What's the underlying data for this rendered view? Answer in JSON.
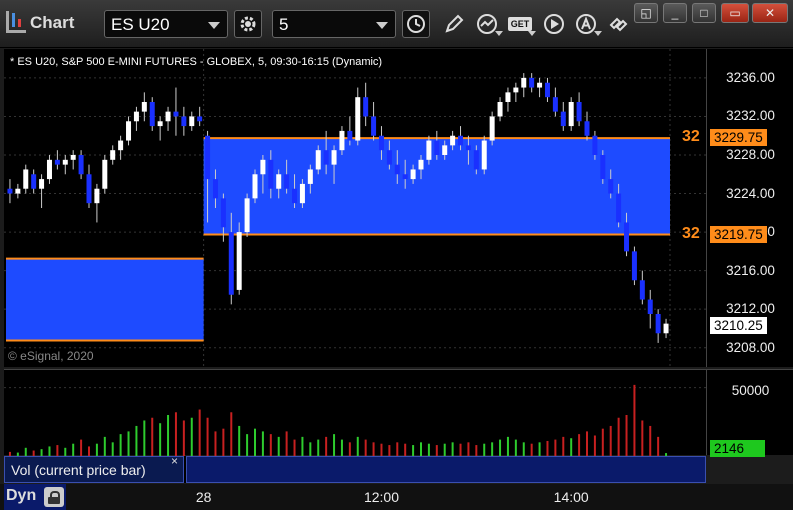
{
  "toolbar": {
    "app_title": "Chart",
    "symbol": "ES U20",
    "interval": "5",
    "get_label": "GET",
    "icons": [
      "gear-icon",
      "clock-icon",
      "pencil-icon",
      "study-icon",
      "get-data-icon",
      "play-icon",
      "text-icon",
      "link-icon"
    ]
  },
  "window": {
    "buttons": [
      "restore-icon",
      "minimize-icon",
      "maximize-icon",
      "close-icon"
    ]
  },
  "chart": {
    "header": "* ES U20, S&P 500 E-MINI FUTURES - GLOBEX, 5, 09:30-16:15 (Dynamic)",
    "copyright": "© eSignal, 2020",
    "price_axis_labels": [
      "3236.00",
      "3232.00",
      "3228.00",
      "3224.00",
      "3220.00",
      "3216.00",
      "3212.00",
      "3208.00"
    ],
    "upper_line_price": "3229.75",
    "lower_line_price": "3219.75",
    "last_price": "3210.25",
    "edge_label": "32",
    "volume_axis_label": "50000",
    "last_volume": "2146",
    "volume_panel_title": "Vol (current price bar)",
    "volume_panel_close": "×",
    "time_labels": [
      "28",
      "12:00",
      "14:00"
    ],
    "dyn_label": "Dyn",
    "colors": {
      "background": "#000000",
      "up_bar": "#ffffff",
      "down_bar": "#1a30ff",
      "zone_fill": "#1e4bff",
      "level_line": "#ff8c1a",
      "vol_up": "#2ecc2e",
      "vol_down": "#c82020"
    }
  },
  "chart_data": {
    "type": "bar",
    "title": "",
    "ylim": [
      3206,
      3239
    ],
    "ohlc": [
      [
        3224.5,
        3225.5,
        3223.0,
        3224.0
      ],
      [
        3224.0,
        3225.0,
        3223.5,
        3224.5
      ],
      [
        3224.5,
        3227.0,
        3224.0,
        3226.5
      ],
      [
        3226.0,
        3226.5,
        3224.0,
        3224.5
      ],
      [
        3224.5,
        3226.0,
        3222.5,
        3225.5
      ],
      [
        3225.5,
        3228.0,
        3225.0,
        3227.5
      ],
      [
        3227.5,
        3228.5,
        3226.5,
        3227.0
      ],
      [
        3227.0,
        3228.0,
        3226.0,
        3227.5
      ],
      [
        3227.5,
        3228.5,
        3226.5,
        3228.0
      ],
      [
        3228.0,
        3228.5,
        3225.5,
        3226.0
      ],
      [
        3226.0,
        3227.0,
        3222.5,
        3223.0
      ],
      [
        3223.0,
        3225.0,
        3221.0,
        3224.5
      ],
      [
        3224.5,
        3228.0,
        3224.0,
        3227.5
      ],
      [
        3227.5,
        3229.0,
        3227.0,
        3228.5
      ],
      [
        3228.5,
        3230.0,
        3227.5,
        3229.5
      ],
      [
        3229.5,
        3232.0,
        3229.0,
        3231.5
      ],
      [
        3231.5,
        3233.0,
        3230.5,
        3232.5
      ],
      [
        3232.5,
        3234.5,
        3231.5,
        3233.5
      ],
      [
        3233.5,
        3234.0,
        3230.5,
        3231.0
      ],
      [
        3231.0,
        3232.0,
        3229.5,
        3231.5
      ],
      [
        3231.5,
        3233.0,
        3230.5,
        3232.5
      ],
      [
        3232.5,
        3235.0,
        3230.0,
        3232.0
      ],
      [
        3232.0,
        3233.0,
        3230.0,
        3231.0
      ],
      [
        3231.0,
        3232.5,
        3230.5,
        3232.0
      ],
      [
        3232.0,
        3233.0,
        3231.0,
        3231.5
      ],
      [
        3230.0,
        3230.5,
        3221.0,
        3225.5
      ],
      [
        3225.5,
        3226.5,
        3222.5,
        3223.5
      ],
      [
        3223.5,
        3224.0,
        3219.0,
        3220.5
      ],
      [
        3220.0,
        3222.0,
        3212.5,
        3213.5
      ],
      [
        3214.0,
        3221.0,
        3213.5,
        3220.0
      ],
      [
        3220.0,
        3224.0,
        3219.5,
        3223.5
      ],
      [
        3223.5,
        3226.5,
        3223.0,
        3226.0
      ],
      [
        3226.0,
        3228.0,
        3224.0,
        3227.5
      ],
      [
        3227.5,
        3228.5,
        3223.5,
        3224.5
      ],
      [
        3224.5,
        3226.5,
        3223.5,
        3226.0
      ],
      [
        3226.0,
        3227.5,
        3224.0,
        3224.5
      ],
      [
        3224.5,
        3226.0,
        3222.5,
        3223.0
      ],
      [
        3223.0,
        3225.5,
        3222.5,
        3225.0
      ],
      [
        3225.0,
        3227.0,
        3224.0,
        3226.5
      ],
      [
        3226.5,
        3229.0,
        3226.0,
        3228.5
      ],
      [
        3228.5,
        3230.5,
        3226.0,
        3227.0
      ],
      [
        3227.0,
        3229.0,
        3225.0,
        3228.5
      ],
      [
        3228.5,
        3231.0,
        3228.0,
        3230.5
      ],
      [
        3230.5,
        3232.0,
        3229.0,
        3229.5
      ],
      [
        3229.5,
        3235.0,
        3229.0,
        3234.0
      ],
      [
        3234.0,
        3235.5,
        3231.0,
        3232.0
      ],
      [
        3232.0,
        3233.5,
        3229.5,
        3230.0
      ],
      [
        3230.0,
        3231.0,
        3227.5,
        3228.5
      ],
      [
        3228.5,
        3229.5,
        3226.5,
        3227.0
      ],
      [
        3227.0,
        3228.5,
        3225.0,
        3226.0
      ],
      [
        3226.0,
        3227.5,
        3224.5,
        3225.5
      ],
      [
        3225.5,
        3227.0,
        3225.0,
        3226.5
      ],
      [
        3226.5,
        3228.0,
        3225.5,
        3227.5
      ],
      [
        3227.5,
        3230.0,
        3227.0,
        3229.5
      ],
      [
        3229.5,
        3230.5,
        3227.5,
        3228.0
      ],
      [
        3228.0,
        3229.5,
        3227.5,
        3229.0
      ],
      [
        3229.0,
        3230.5,
        3228.5,
        3230.0
      ],
      [
        3230.0,
        3231.0,
        3228.5,
        3229.0
      ],
      [
        3229.0,
        3230.0,
        3227.0,
        3228.5
      ],
      [
        3228.5,
        3229.0,
        3226.0,
        3226.5
      ],
      [
        3226.5,
        3230.0,
        3226.0,
        3229.5
      ],
      [
        3229.5,
        3232.5,
        3229.0,
        3232.0
      ],
      [
        3232.0,
        3234.0,
        3231.5,
        3233.5
      ],
      [
        3233.5,
        3235.0,
        3232.5,
        3234.5
      ],
      [
        3234.5,
        3235.5,
        3233.5,
        3235.0
      ],
      [
        3235.0,
        3236.5,
        3234.0,
        3236.0
      ],
      [
        3236.0,
        3236.5,
        3234.5,
        3235.0
      ],
      [
        3235.0,
        3236.0,
        3234.0,
        3235.5
      ],
      [
        3235.5,
        3236.0,
        3233.5,
        3234.0
      ],
      [
        3234.0,
        3235.0,
        3232.0,
        3232.5
      ],
      [
        3232.5,
        3233.5,
        3230.5,
        3231.0
      ],
      [
        3231.0,
        3234.0,
        3230.5,
        3233.5
      ],
      [
        3233.5,
        3234.5,
        3231.0,
        3231.5
      ],
      [
        3231.5,
        3232.5,
        3229.5,
        3230.0
      ],
      [
        3230.0,
        3230.5,
        3227.5,
        3228.0
      ],
      [
        3228.0,
        3228.5,
        3225.0,
        3225.5
      ],
      [
        3225.5,
        3226.5,
        3223.5,
        3224.0
      ],
      [
        3224.0,
        3225.0,
        3220.5,
        3221.0
      ],
      [
        3221.0,
        3222.0,
        3217.5,
        3218.0
      ],
      [
        3218.0,
        3218.5,
        3214.5,
        3215.0
      ],
      [
        3215.0,
        3216.0,
        3212.5,
        3213.0
      ],
      [
        3213.0,
        3214.0,
        3210.0,
        3211.5
      ],
      [
        3211.5,
        3212.0,
        3208.5,
        3209.5
      ],
      [
        3209.5,
        3211.0,
        3209.0,
        3210.5
      ]
    ],
    "zones": [
      {
        "from_bar": 0,
        "to_bar": 24,
        "top": 3217.25,
        "bottom": 3208.75
      },
      {
        "from_bar": 25,
        "to_bar": 83,
        "top": 3229.75,
        "bottom": 3219.75
      }
    ],
    "volume": [
      3000,
      2500,
      6000,
      4000,
      5000,
      7000,
      8000,
      6000,
      9000,
      12000,
      7000,
      9000,
      14000,
      10000,
      16000,
      18000,
      22000,
      26000,
      28000,
      24000,
      30000,
      32000,
      26000,
      28000,
      34000,
      28000,
      18000,
      20000,
      32000,
      22000,
      16000,
      20000,
      18000,
      16000,
      14000,
      18000,
      12000,
      14000,
      10000,
      12000,
      14000,
      16000,
      12000,
      10000,
      14000,
      12000,
      10000,
      9000,
      8000,
      10000,
      9000,
      8000,
      10000,
      9000,
      8000,
      9000,
      10000,
      9000,
      10000,
      8000,
      9000,
      10000,
      12000,
      14000,
      12000,
      10000,
      9000,
      10000,
      11000,
      12000,
      14000,
      13000,
      16000,
      18000,
      15000,
      20000,
      22000,
      28000,
      30000,
      52000,
      26000,
      22000,
      14000,
      2146
    ],
    "volume_ylim": [
      0,
      60000
    ]
  }
}
